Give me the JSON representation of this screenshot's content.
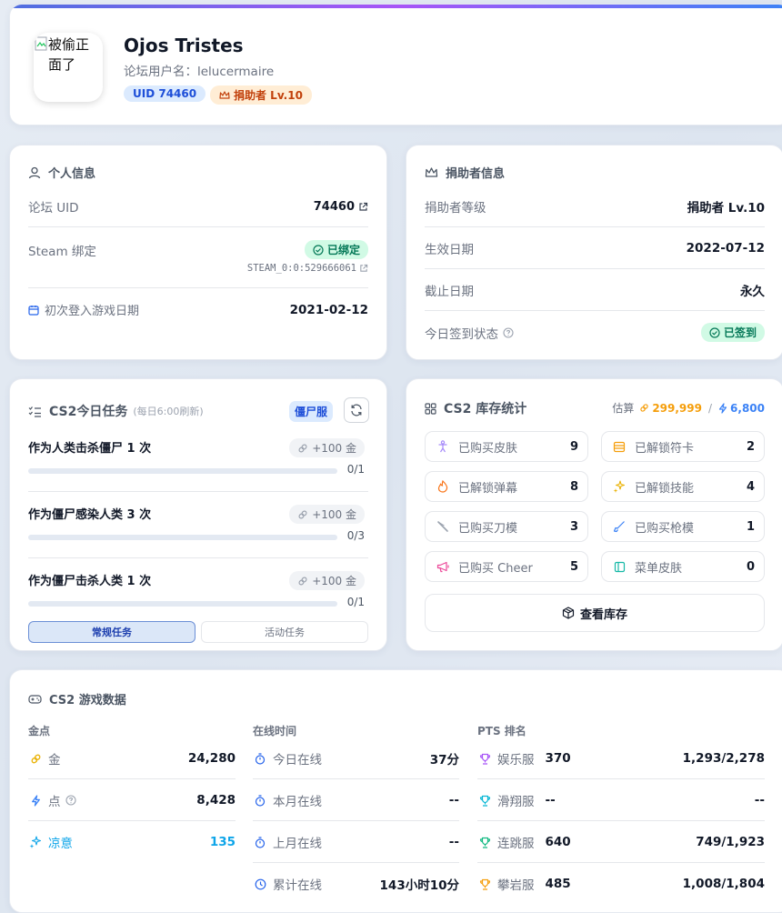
{
  "profile": {
    "avatar_alt": "被偷正面了",
    "name": "Ojos Tristes",
    "forum_username_label": "论坛用户名：",
    "forum_username": "lelucermaire",
    "uid_badge": "UID 74460",
    "donor_badge": "捐助者 Lv.10"
  },
  "personal": {
    "title": "个人信息",
    "uid_label": "论坛 UID",
    "uid_value": "74460",
    "steam_label": "Steam 绑定",
    "steam_status": "已绑定",
    "steam_id": "STEAM_0:0:529666061",
    "first_login_label": "初次登入游戏日期",
    "first_login_value": "2021-02-12"
  },
  "donor": {
    "title": "捐助者信息",
    "level_label": "捐助者等级",
    "level_value": "捐助者 Lv.10",
    "start_label": "生效日期",
    "start_value": "2022-07-12",
    "end_label": "截止日期",
    "end_value": "永久",
    "checkin_label": "今日签到状态",
    "checkin_value": "已签到"
  },
  "tasks": {
    "title": "CS2今日任务",
    "subtitle": "(每日6:00刷新)",
    "server_badge": "僵尸服",
    "items": [
      {
        "name": "作为人类击杀僵尸 1 次",
        "reward": "+100 金",
        "progress": "0/1",
        "fraction": 0
      },
      {
        "name": "作为僵尸感染人类 3 次",
        "reward": "+100 金",
        "progress": "0/3",
        "fraction": 0
      },
      {
        "name": "作为僵尸击杀人类 1 次",
        "reward": "+100 金",
        "progress": "0/1",
        "fraction": 0
      }
    ],
    "tab_regular": "常规任务",
    "tab_event": "活动任务"
  },
  "inventory": {
    "title": "CS2 库存统计",
    "estimate_label": "估算",
    "gold_estimate": "299,999",
    "separator": "/",
    "points_estimate": "6,800",
    "items": [
      {
        "label": "已购买皮肤",
        "value": "9"
      },
      {
        "label": "已解锁符卡",
        "value": "2"
      },
      {
        "label": "已解锁弹幕",
        "value": "8"
      },
      {
        "label": "已解锁技能",
        "value": "4"
      },
      {
        "label": "已购买刀模",
        "value": "3"
      },
      {
        "label": "已购买枪模",
        "value": "1"
      },
      {
        "label": "已购买 Cheer",
        "value": "5"
      },
      {
        "label": "菜单皮肤",
        "value": "0"
      }
    ],
    "view_button": "查看库存"
  },
  "game": {
    "title": "CS2 游戏数据",
    "currency_header": "金点",
    "gold_label": "金",
    "gold_value": "24,280",
    "points_label": "点",
    "points_value": "8,428",
    "cool_label": "凉意",
    "cool_value": "135",
    "online_header": "在线时间",
    "online": [
      {
        "label": "今日在线",
        "value": "37分"
      },
      {
        "label": "本月在线",
        "value": "--"
      },
      {
        "label": "上月在线",
        "value": "--"
      },
      {
        "label": "累计在线",
        "value": "143小时10分"
      }
    ],
    "pts_header": "PTS 排名",
    "pts": [
      {
        "server": "娱乐服",
        "score": "370",
        "rank": "1,293/2,278"
      },
      {
        "server": "滑翔服",
        "score": "--",
        "rank": "--"
      },
      {
        "server": "连跳服",
        "score": "640",
        "rank": "749/1,923"
      },
      {
        "server": "攀岩服",
        "score": "485",
        "rank": "1,008/1,804"
      }
    ]
  },
  "colors": {
    "accent_blue": "#2563eb",
    "gold": "#f59e0b",
    "green": "#047857",
    "cyan": "#0ea5e9"
  }
}
